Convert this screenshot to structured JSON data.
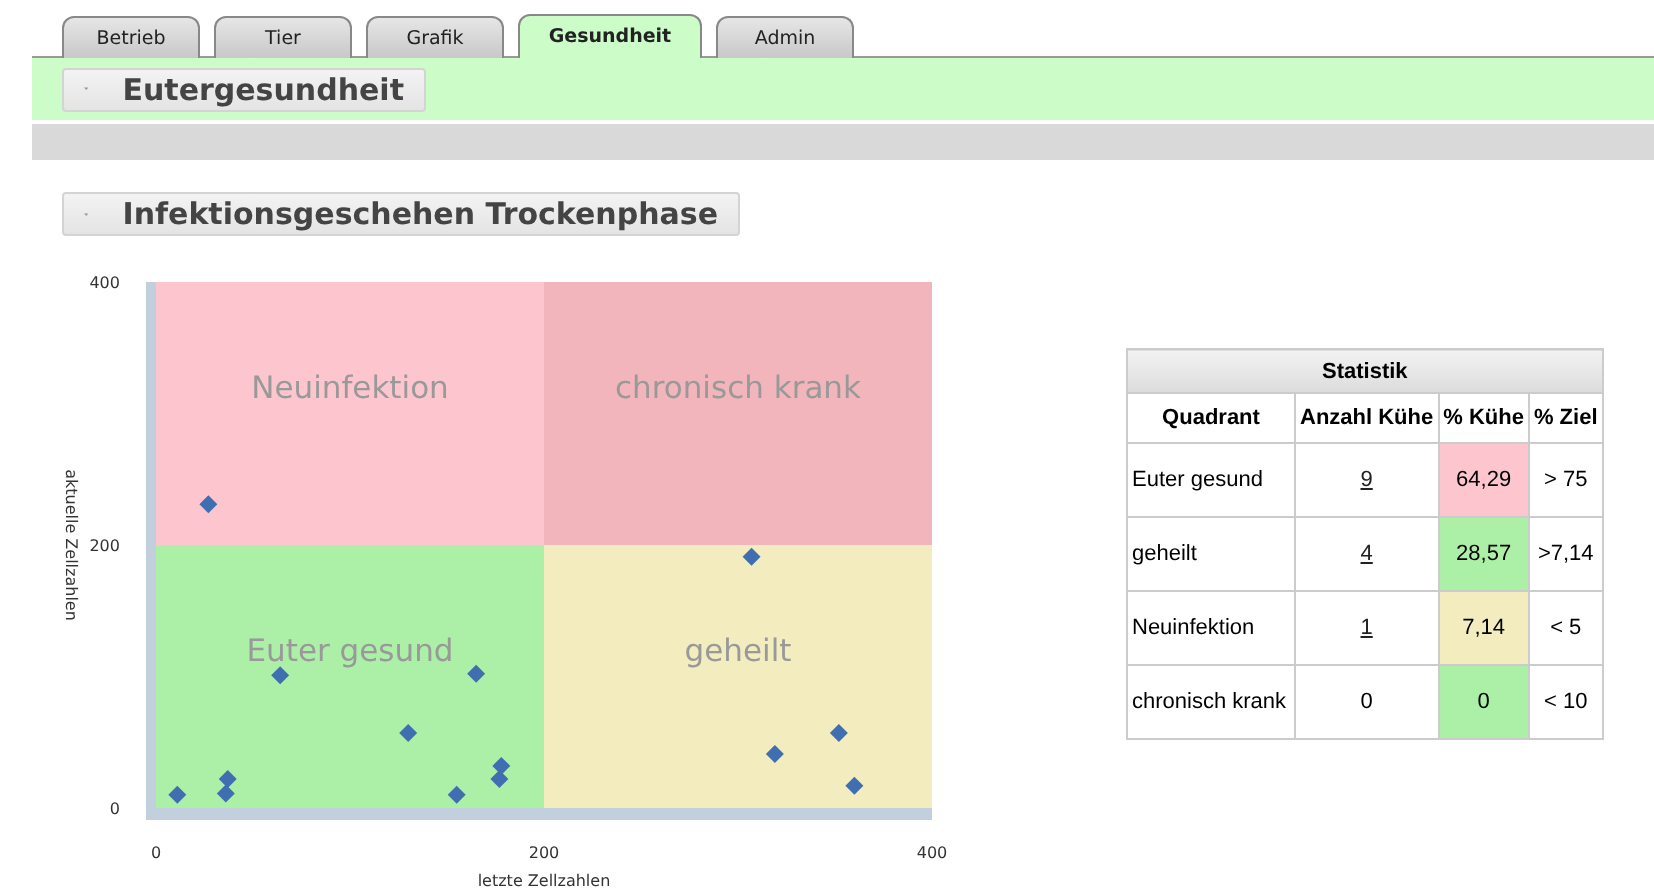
{
  "tabs": [
    {
      "label": "Betrieb",
      "selected": false
    },
    {
      "label": "Tier",
      "selected": false
    },
    {
      "label": "Grafik",
      "selected": false
    },
    {
      "label": "Gesundheit",
      "selected": true
    },
    {
      "label": "Admin",
      "selected": false
    }
  ],
  "section_header": {
    "title": "Eutergesundheit",
    "expanded": true
  },
  "panel": {
    "title": "Infektionsgeschehen Trockenphase",
    "expanded": true,
    "quadrants": [
      {
        "color": "#fdc6cf"
      },
      {
        "color": "#f3b5bc"
      },
      {
        "color": "#acf0a8"
      },
      {
        "color": "#f2ecbe"
      }
    ],
    "chart_data": {
      "type": "scatter",
      "xlabel": "letzte Zellzahlen",
      "ylabel": "aktuelle Zellzahlen",
      "xlim": [
        0,
        400
      ],
      "ylim": [
        0,
        400
      ],
      "xticks": [
        {
          "value": 0,
          "label": "0"
        },
        {
          "value": 200,
          "label": "200"
        },
        {
          "value": 400,
          "label": "400"
        }
      ],
      "yticks": [
        {
          "value": 0,
          "label": "0"
        },
        {
          "value": 200,
          "label": "200"
        },
        {
          "value": 400,
          "label": "400"
        }
      ],
      "x": [
        11,
        27,
        37,
        36,
        64,
        130,
        155,
        165,
        177,
        178,
        307,
        319,
        352,
        360
      ],
      "series": [
        {
          "color": "#3f6fb0",
          "values": [
            10,
            231,
            22,
            11,
            101,
            57,
            10,
            102,
            22,
            32,
            191,
            41,
            57,
            17
          ]
        }
      ],
      "annotations": [
        "Neuinfektion",
        "chronisch krank",
        "Euter gesund",
        "geheilt"
      ]
    }
  },
  "statistics": {
    "title": "Statistik",
    "columns": [
      "Quadrant",
      "Anzahl Kühe",
      "% Kühe",
      "% Ziel"
    ],
    "rows": [
      {
        "quadrant": "Euter gesund",
        "count": "9",
        "link": true,
        "percent": "64,29",
        "color": "#fdc6cf",
        "target": "> 75"
      },
      {
        "quadrant": "geheilt",
        "count": "4",
        "link": true,
        "percent": "28,57",
        "color": "#acf0a8",
        "target": ">7,14"
      },
      {
        "quadrant": "Neuinfektion",
        "count": "1",
        "link": true,
        "percent": "7,14",
        "color": "#f2ecbe",
        "target": "< 5"
      },
      {
        "quadrant": "chronisch krank",
        "count": "0",
        "link": false,
        "percent": "0",
        "color": "#acf0a8",
        "target": "< 10"
      }
    ]
  }
}
